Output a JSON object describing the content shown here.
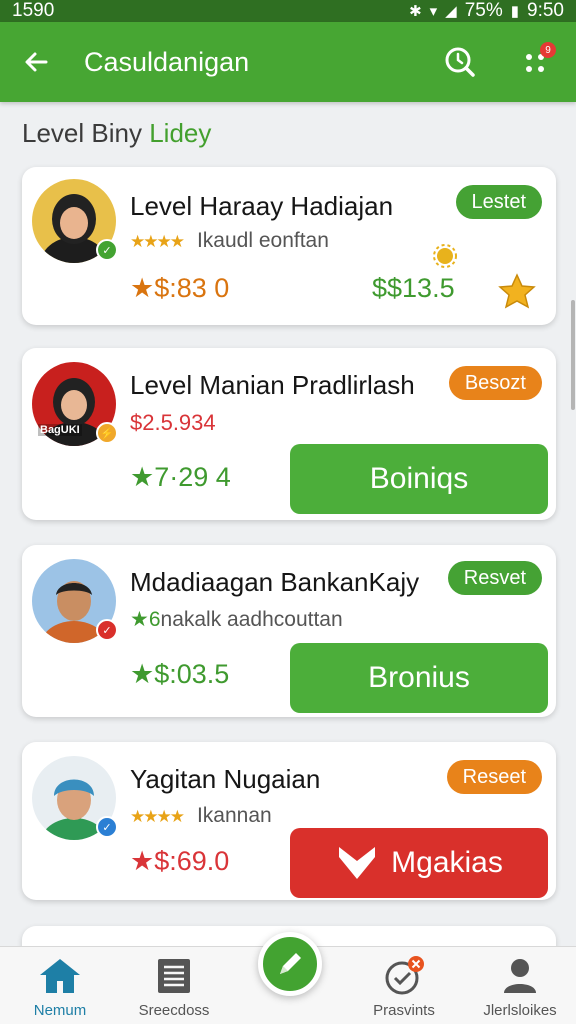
{
  "status_bar": {
    "left_text": "1590",
    "battery": "75%",
    "time": "9:50"
  },
  "app_bar": {
    "title": "Casuldanigan",
    "back_icon": "arrow-left-icon",
    "search_icon": "search-icon",
    "menu_icon": "grid-dots-icon",
    "notification_count": "9"
  },
  "section": {
    "title_main": "Level Biny",
    "title_accent": "Lidey"
  },
  "cards": [
    {
      "name": "Level Haraay Hadiajan",
      "status": "Lestet",
      "rating_stars": "★★★★",
      "subtitle": "Ikaudl eonftan",
      "price_left": "★$:83 0",
      "price_right": "$$13.5"
    },
    {
      "name": "Level Manian Pradlirlash",
      "status": "Besozt",
      "subtitle": "$2.5.934",
      "avatar_text": "BagUKI",
      "price_left": "★7·29 4",
      "button": "Boiniqs"
    },
    {
      "name": "Mdadiaagan BankanKajy",
      "status": "Resvet",
      "subtitle_prefix": "★6",
      "subtitle": "nakalk aadhcouttan",
      "price_left": "★$:03.5",
      "button": "Bronius"
    },
    {
      "name": "Yagitan Nugaian",
      "status": "Reseet",
      "rating_stars": "★★★★",
      "subtitle": "Ikannan",
      "price_left": "★$:69.0",
      "button": "Mgakias"
    }
  ],
  "bottom_nav": [
    {
      "label": "Nemum",
      "icon": "home-icon",
      "active": true
    },
    {
      "label": "Sreecdoss",
      "icon": "document-icon",
      "active": false
    },
    {
      "label": "Prasvints",
      "icon": "check-circle-icon",
      "active": false
    },
    {
      "label": "Jlerlsloikes",
      "icon": "person-icon",
      "active": false
    }
  ],
  "fab_icon": "pencil-icon",
  "colors": {
    "primary": "#47a633",
    "status_bar": "#2f6f22",
    "accent_orange": "#e8831a",
    "danger": "#d9302b",
    "price_orange": "#d9740f",
    "price_green": "#3f9a2f",
    "price_red": "#d93438",
    "nav_active": "#1e7fa6"
  }
}
